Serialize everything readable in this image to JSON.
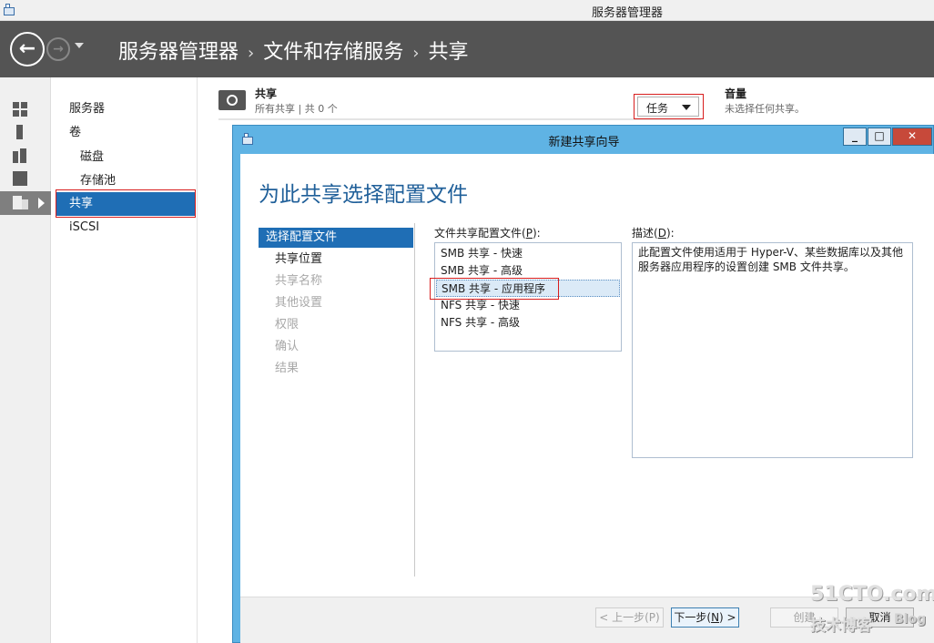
{
  "window": {
    "title": "服务器管理器"
  },
  "header": {
    "back_icon": "back-arrow-icon",
    "forward_icon": "forward-arrow-icon",
    "breadcrumb": [
      "服务器管理器",
      "文件和存储服务",
      "共享"
    ]
  },
  "nav": {
    "items": [
      {
        "label": "服务器",
        "sub": false,
        "selected": false
      },
      {
        "label": "卷",
        "sub": false,
        "selected": false
      },
      {
        "label": "磁盘",
        "sub": true,
        "selected": false
      },
      {
        "label": "存储池",
        "sub": true,
        "selected": false
      },
      {
        "label": "共享",
        "sub": false,
        "selected": true
      },
      {
        "label": "iSCSI",
        "sub": false,
        "selected": false
      }
    ]
  },
  "shares_panel": {
    "title": "共享",
    "subtitle": "所有共享 | 共 0 个",
    "tasks_label": "任务"
  },
  "volume_panel": {
    "title": "音量",
    "subtitle": "未选择任何共享。"
  },
  "dialog": {
    "title": "新建共享向导",
    "heading": "为此共享选择配置文件",
    "steps": [
      {
        "label": "选择配置文件",
        "state": "active"
      },
      {
        "label": "共享位置",
        "state": "normal"
      },
      {
        "label": "共享名称",
        "state": "disabled"
      },
      {
        "label": "其他设置",
        "state": "disabled"
      },
      {
        "label": "权限",
        "state": "disabled"
      },
      {
        "label": "确认",
        "state": "disabled"
      },
      {
        "label": "结果",
        "state": "disabled"
      }
    ],
    "profile_label": "文件共享配置文件(",
    "profile_key": "P",
    "profile_label_end": "):",
    "profiles": [
      "SMB 共享 - 快速",
      "SMB 共享 - 高级",
      "SMB 共享 - 应用程序",
      "NFS 共享 - 快速",
      "NFS 共享 - 高级"
    ],
    "selected_profile_index": 2,
    "desc_label": "描述(",
    "desc_key": "D",
    "desc_label_end": "):",
    "description": "此配置文件使用适用于 Hyper-V、某些数据库以及其他服务器应用程序的设置创建 SMB 文件共享。",
    "buttons": {
      "prev": "< 上一步(P)",
      "next_a": "下一步(",
      "next_key": "N",
      "next_b": ") >",
      "create": "创建",
      "cancel": "取消"
    }
  },
  "watermark": {
    "line1": "51CTO.com",
    "line2": "技术博客",
    "line3": "Blog"
  },
  "colors": {
    "accent": "#1f6eb5",
    "dialog_frame": "#5fb3e4",
    "header": "#545454",
    "highlight": "#d81e1e"
  }
}
